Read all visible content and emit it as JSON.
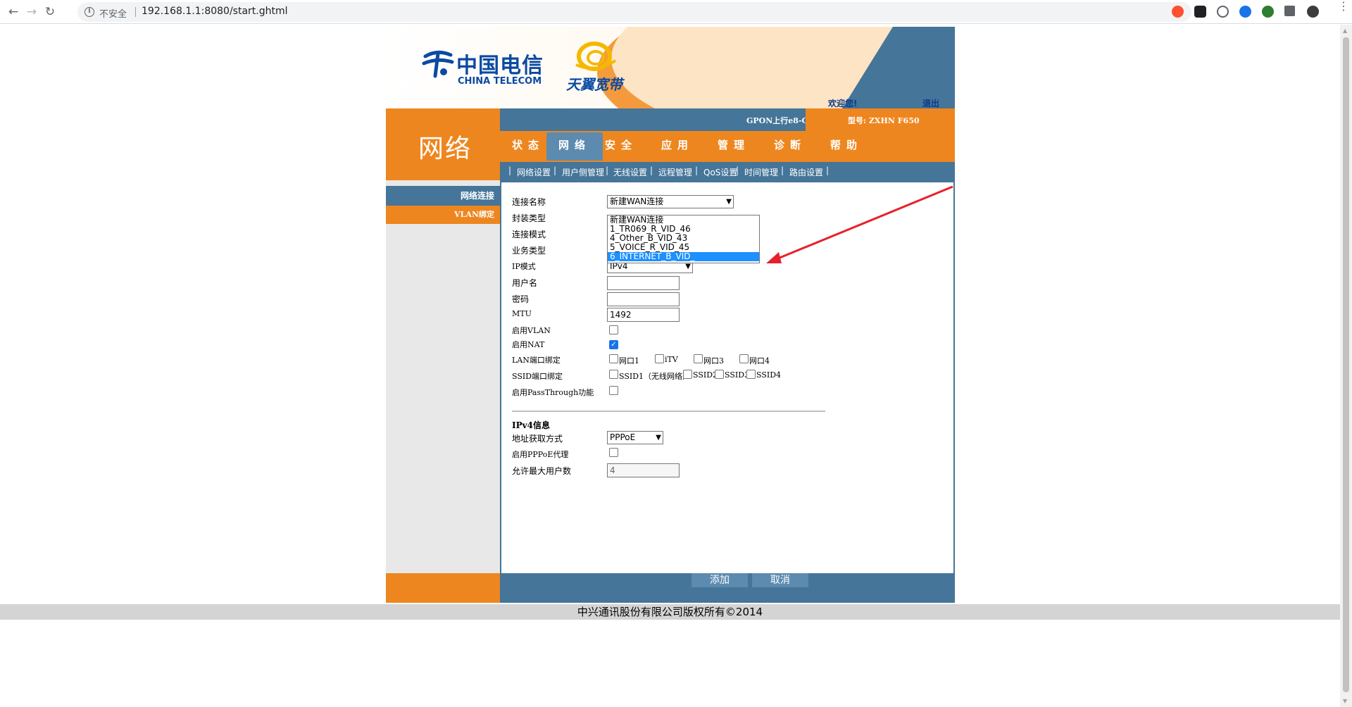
{
  "browser": {
    "insecure_label": "不安全",
    "url": "192.168.1.1:8080/start.ghtml",
    "back_icon": "arrow-left-icon",
    "forward_icon": "arrow-right-icon",
    "reload_icon": "reload-icon",
    "bookmark_icon": "star-icon"
  },
  "banner": {
    "brand_cn": "中国电信",
    "brand_en": "CHINA TELECOM",
    "product": "天翼宽带",
    "welcome": "欢迎您!",
    "logout": "退出"
  },
  "section_title": "网络",
  "model_bar": {
    "gpon": "GPON上行e8-C",
    "model": "型号: ZXHN F650"
  },
  "main_tabs": [
    {
      "label": "状态"
    },
    {
      "label": "网络",
      "active": true
    },
    {
      "label": "安全"
    },
    {
      "label": "应用"
    },
    {
      "label": "管理"
    },
    {
      "label": "诊断"
    },
    {
      "label": "帮助"
    }
  ],
  "sub_tabs": [
    "网络设置",
    "用户侧管理",
    "无线设置",
    "远程管理",
    "QoS设置",
    "时间管理",
    "路由设置"
  ],
  "sidebar": {
    "items": [
      {
        "label": "网络连接"
      },
      {
        "label": "VLAN绑定"
      }
    ]
  },
  "form": {
    "connection_name_label": "连接名称",
    "connection_name_value": "新建WAN连接",
    "connection_options": [
      "新建WAN连接",
      "1_TR069_R_VID_46",
      "4_Other_B_VID_43",
      "5_VOICE_R_VID_45",
      "6_INTERNET_B_VID_"
    ],
    "selected_option_index": 4,
    "encap_label": "封装类型",
    "conn_mode_label": "连接模式",
    "service_label": "业务类型",
    "ip_mode_label": "IP模式",
    "ip_mode_value": "IPv4",
    "username_label": "用户名",
    "username_value": "",
    "password_label": "密码",
    "password_value": "",
    "mtu_label": "MTU",
    "mtu_value": "1492",
    "vlan_label": "启用VLAN",
    "vlan_checked": false,
    "nat_label": "启用NAT",
    "nat_checked": true,
    "lan_bind_label": "LAN端口绑定",
    "lan_ports": [
      "网口1",
      "iTV",
      "网口3",
      "网口4"
    ],
    "ssid_bind_label": "SSID端口绑定",
    "ssids": [
      "SSID1（无线网络）",
      "SSID2",
      "SSID3",
      "SSID4"
    ],
    "passthrough_label": "启用PassThrough功能",
    "ipv4_section_title": "IPv4信息",
    "addr_method_label": "地址获取方式",
    "addr_method_value": "PPPoE",
    "pppoe_proxy_label": "启用PPPoE代理",
    "max_users_label": "允许最大用户数",
    "max_users_value": "4"
  },
  "footer_buttons": {
    "add": "添加",
    "cancel": "取消"
  },
  "copyright": "中兴通讯股份有限公司版权所有©2014",
  "colors": {
    "orange": "#ee861f",
    "blue": "#457599",
    "highlight": "#1e90ff",
    "arrow": "#e8202a"
  }
}
